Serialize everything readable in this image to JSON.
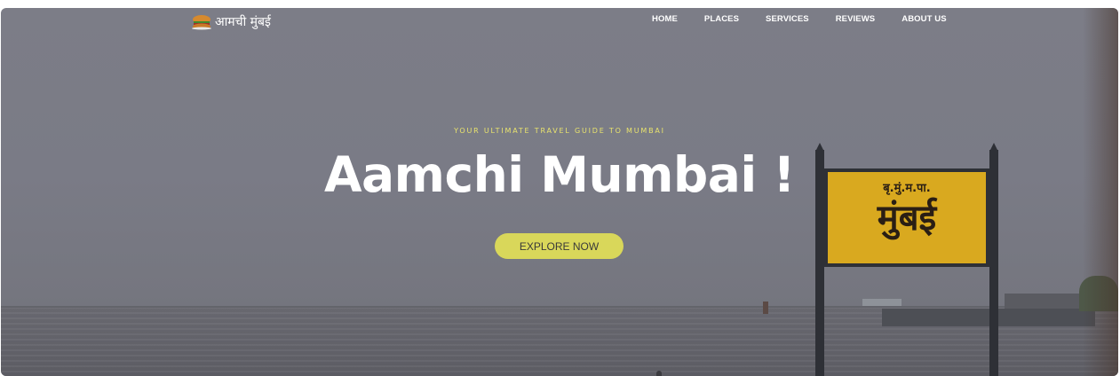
{
  "nav": {
    "brand_text": "आमची मुंबई",
    "brand_icon": "vada-pav-icon",
    "links": [
      "HOME",
      "PLACES",
      "SERVICES",
      "REVIEWS",
      "ABOUT US"
    ]
  },
  "hero": {
    "tagline": "YOUR ULTIMATE TRAVEL GUIDE TO MUMBAI",
    "title": "Aamchi Mumbai !",
    "cta_label": "EXPLORE NOW",
    "sign_small": "बृ.मुं.म.पा.",
    "sign_big": "मुंबई"
  },
  "colors": {
    "accent": "#d9d75a",
    "tagline": "#e8e36d",
    "sign": "#d9a91f"
  }
}
